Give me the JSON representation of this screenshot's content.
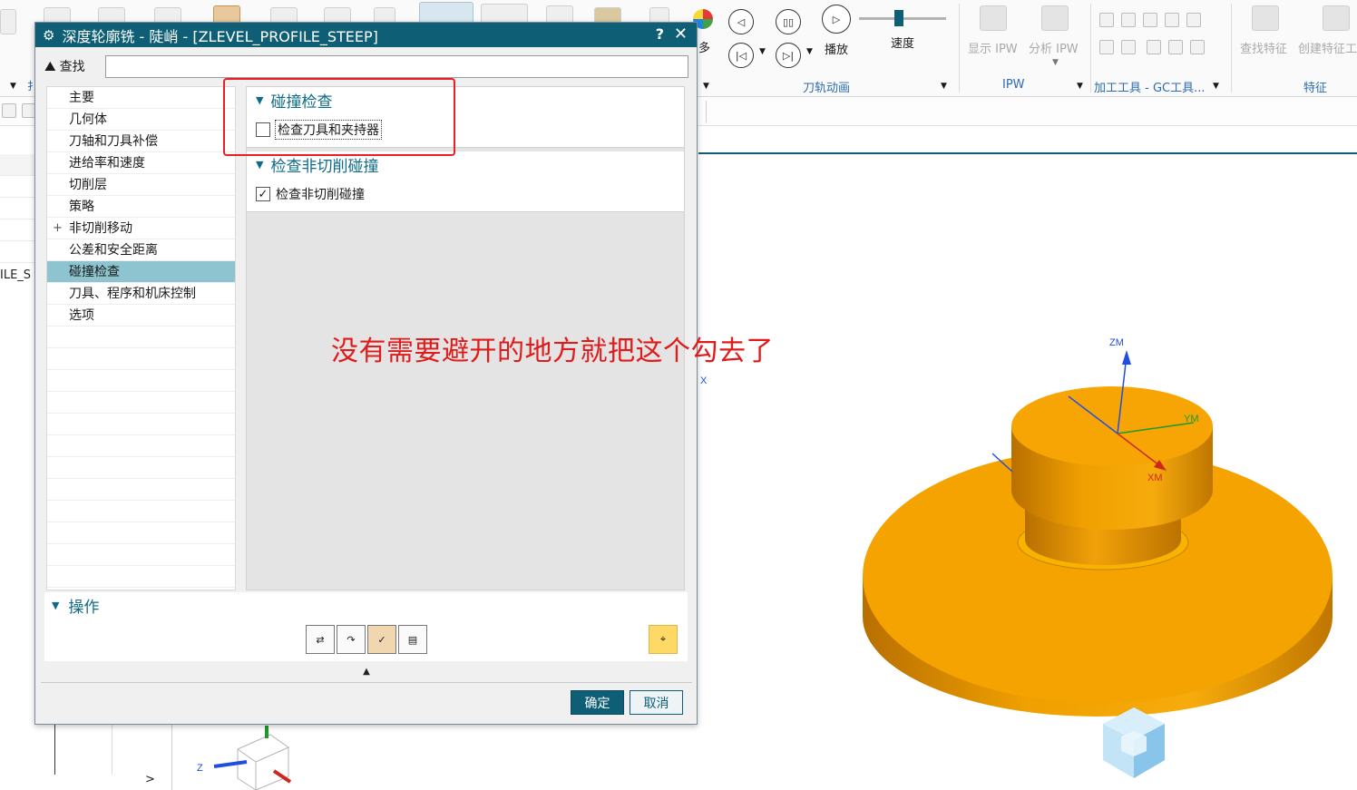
{
  "dialog": {
    "title": "深度轮廓铣 - 陡峭 - [ZLEVEL_PROFILE_STEEP]",
    "help": "?",
    "close": "✕",
    "search_label": "查找",
    "search_value": "",
    "tree": [
      {
        "label": "主要",
        "expandable": false,
        "selected": false
      },
      {
        "label": "几何体",
        "expandable": false,
        "selected": false
      },
      {
        "label": "刀轴和刀具补偿",
        "expandable": false,
        "selected": false
      },
      {
        "label": "进给率和速度",
        "expandable": false,
        "selected": false
      },
      {
        "label": "切削层",
        "expandable": false,
        "selected": false
      },
      {
        "label": "策略",
        "expandable": false,
        "selected": false
      },
      {
        "label": "非切削移动",
        "expandable": true,
        "selected": false
      },
      {
        "label": "公差和安全距离",
        "expandable": false,
        "selected": false
      },
      {
        "label": "碰撞检查",
        "expandable": false,
        "selected": true
      },
      {
        "label": "刀具、程序和机床控制",
        "expandable": false,
        "selected": false
      },
      {
        "label": "选项",
        "expandable": false,
        "selected": false
      }
    ],
    "sections": {
      "collision": {
        "title": "碰撞检查",
        "checkbox_label": "检查刀具和夹持器",
        "checked": false
      },
      "noncut": {
        "title": "检查非切削碰撞",
        "checkbox_label": "检查非切削碰撞",
        "checked": true
      }
    },
    "operations_title": "操作",
    "ok": "确定",
    "cancel": "取消"
  },
  "annotation": "没有需要避开的地方就把这个勾去了",
  "ribbon": {
    "play_label": "播放",
    "speed_label": "速度",
    "speed_fraction": 0.45,
    "more_label": "多",
    "show_ipw": "显示 IPW",
    "analyze_ipw": "分析 IPW",
    "find_feature": "查找特征",
    "create_feature": "创建特征工",
    "groups": {
      "tool_path_anim": "刀轨动画",
      "ipw": "IPW",
      "machining_tools": "加工工具 - GC工具...",
      "feature": "特征"
    }
  },
  "navigator": {
    "fragment": "ILE_S"
  },
  "axes": {
    "zm": "ZM",
    "ym": "YM",
    "xm": "XM",
    "z": "Z",
    "x": "X"
  },
  "colors": {
    "dialog_title_bg": "#0e5f76",
    "selected_row": "#8ec3d0",
    "accent": "#0e6c86",
    "annotation": "#e01b1b",
    "model": "#f5a300"
  }
}
